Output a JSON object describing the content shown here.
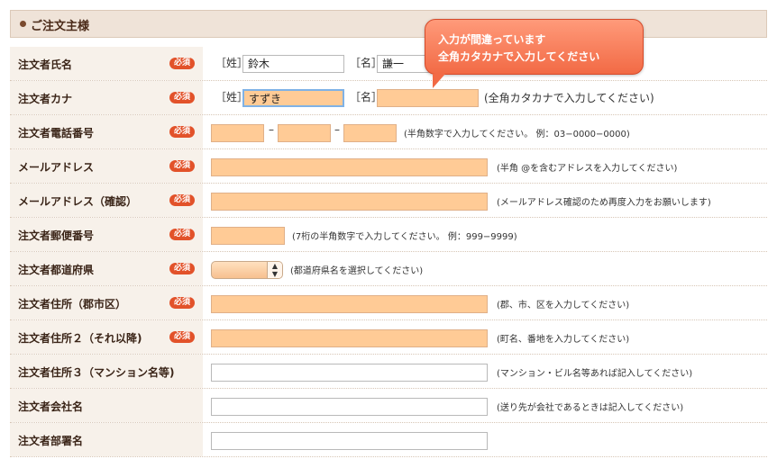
{
  "section": {
    "title": "ご注文主様"
  },
  "badge_label": "必須",
  "tooltip": {
    "line1": "入力が間違っています",
    "line2": "全角カタカナで入力してください"
  },
  "rows": {
    "name": {
      "label": "注文者氏名",
      "sei_bracket": "［姓］",
      "mei_bracket": "［名］",
      "sei_value": "鈴木",
      "mei_value": "謙一"
    },
    "kana": {
      "label": "注文者カナ",
      "sei_bracket": "［姓］",
      "mei_bracket": "［名］",
      "sei_value": "すずき",
      "mei_value": "",
      "hint": "(全角カタカナで入力してください)"
    },
    "phone": {
      "label": "注文者電話番号",
      "dash": "–",
      "hint": "(半角数字で入力してください。 例：03−0000−0000)"
    },
    "email": {
      "label": "メールアドレス",
      "hint": "(半角 @を含むアドレスを入力してください)"
    },
    "email_confirm": {
      "label": "メールアドレス（確認）",
      "hint": "(メールアドレス確認のため再度入力をお願いします)"
    },
    "zip": {
      "label": "注文者郵便番号",
      "hint": "(7桁の半角数字で入力してください。 例：999−9999)"
    },
    "pref": {
      "label": "注文者都道府県",
      "hint": "(都道府県名を選択してください)"
    },
    "addr1": {
      "label": "注文者住所（郡市区）",
      "hint": "(郡、市、区を入力してください)"
    },
    "addr2": {
      "label": "注文者住所２（それ以降)",
      "hint": "(町名、番地を入力してください)"
    },
    "addr3": {
      "label": "注文者住所３（マンション名等)",
      "hint": "(マンション・ビル名等あれば記入してください)"
    },
    "company": {
      "label": "注文者会社名",
      "hint": "(送り先が会社であるときは記入してください)"
    },
    "dept": {
      "label": "注文者部署名"
    }
  }
}
